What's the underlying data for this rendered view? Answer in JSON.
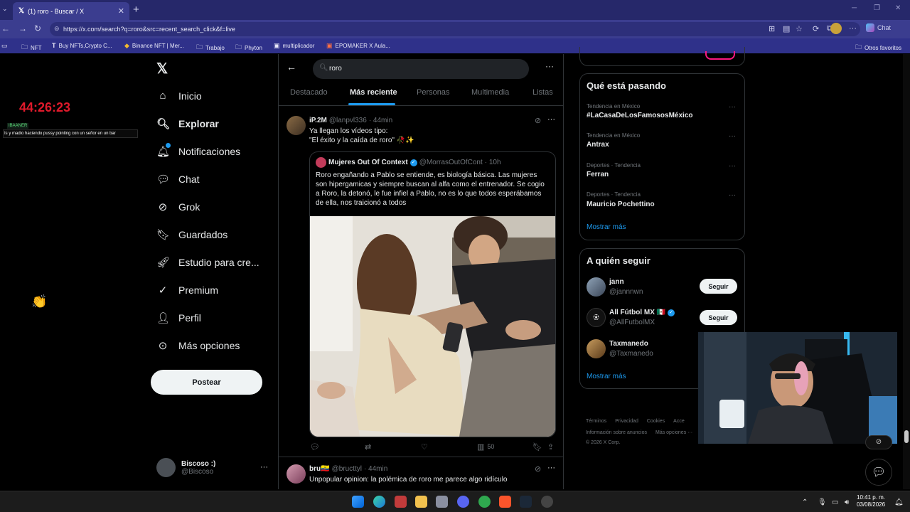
{
  "browser": {
    "tab_title": "(1) roro - Buscar / X",
    "url": "https://x.com/search?q=roro&src=recent_search_click&f=live",
    "chat_label": "Chat",
    "bookmarks": [
      "NFT",
      "Buy NFTs,Crypto C...",
      "Binance NFT | Mer...",
      "Trabajo",
      "Phyton",
      "multiplicador",
      "EPOMAKER X Aula..."
    ],
    "other_bookmarks": "Otros favoritos"
  },
  "overlay": {
    "timer": "44:26:23",
    "user_tag": "IBAANER",
    "message": "Is y madio haciendo pussy pointing con un señor en un bar"
  },
  "nav": {
    "items": [
      "Inicio",
      "Explorar",
      "Notificaciones",
      "Chat",
      "Grok",
      "Guardados",
      "Estudio para cre...",
      "Premium",
      "Perfil",
      "Más opciones"
    ],
    "post_button": "Postear",
    "account_name": "Biscoso :)",
    "account_handle": "@Biscoso"
  },
  "search": {
    "query": "roro",
    "tabs": [
      "Destacado",
      "Más reciente",
      "Personas",
      "Multimedia",
      "Listas"
    ],
    "active_tab": "Más reciente"
  },
  "tweet1": {
    "name": "iP.2M",
    "handle": "@lanpvl336",
    "time": "· 44min",
    "line1": "Ya llegan los vídeos tipo:",
    "line2": "\"El éxito y la caída de roro\" 🥀✨",
    "quote_name": "Mujeres Out Of Context",
    "quote_handle": "@MorrasOutOfCont",
    "quote_time": "· 10h",
    "quote_text": "Roro engañando a Pablo se entiende, es biología básica. Las mujeres son hipergamicas y siempre buscan al alfa como el entrenador. Se cogio a Roro, la detonó, le fue infiel a Pablo, no es lo que todos esperábamos de ella, nos traicionó a todos",
    "views": "50"
  },
  "tweet2": {
    "name": "bru🇪🇨",
    "handle": "@bructtyl",
    "time": "· 44min",
    "text": "Unpopular opinion: la polémica de roro me parece algo ridículo"
  },
  "trends": {
    "heading": "Qué está pasando",
    "items": [
      {
        "meta": "Tendencia en México",
        "name": "#LaCasaDeLosFamososMéxico"
      },
      {
        "meta": "Tendencia en México",
        "name": "Antrax"
      },
      {
        "meta": "Deportes · Tendencia",
        "name": "Ferran"
      },
      {
        "meta": "Deportes · Tendencia",
        "name": "Mauricio Pochettino"
      }
    ],
    "show_more": "Mostrar más"
  },
  "follow": {
    "heading": "A quién seguir",
    "items": [
      {
        "name": "jann",
        "handle": "@jannnwn",
        "button": "Seguir"
      },
      {
        "name": "All Fútbol MX 🇲🇽",
        "handle": "@AllFutbolMX",
        "button": "Seguir"
      },
      {
        "name": "Taxmanedo",
        "handle": "@Taxmanedo",
        "button": ""
      }
    ],
    "show_more": "Mostrar más"
  },
  "footer": {
    "links": [
      "Términos",
      "Privacidad",
      "Cookies",
      "Acce",
      "Información sobre anuncios",
      "Más opciones ···"
    ],
    "copyright": "© 2026 X Corp."
  },
  "taskbar": {
    "time": "10:41 p. m.",
    "date": "03/08/2026"
  },
  "colors": {
    "accent": "#1d9bf0",
    "timer": "#e01a2b",
    "chrome": "#26286a"
  }
}
